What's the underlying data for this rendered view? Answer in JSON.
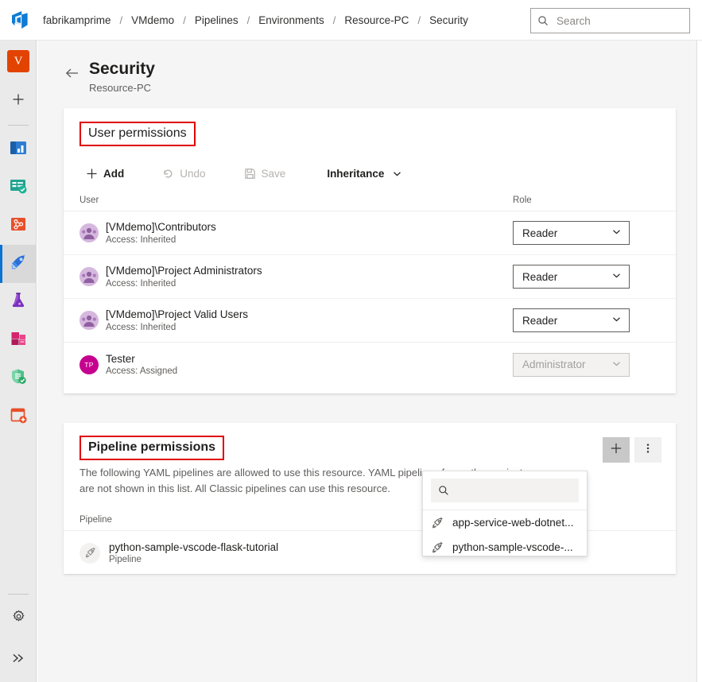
{
  "header": {
    "logo_icon": "azure-devops-logo",
    "breadcrumbs": [
      {
        "label": "fabrikamprime"
      },
      {
        "label": "VMdemo"
      },
      {
        "label": "Pipelines"
      },
      {
        "label": "Environments"
      },
      {
        "label": "Resource-PC"
      },
      {
        "label": "Security"
      }
    ],
    "separator": "/",
    "search": {
      "placeholder": "Search",
      "value": "",
      "icon": "search-icon"
    }
  },
  "sidebar": {
    "org_initial": "V",
    "items": [
      {
        "name": "new-item",
        "icon": "plus-icon",
        "active": false
      },
      {
        "name": "overview",
        "icon": "overview-icon",
        "active": false
      },
      {
        "name": "boards",
        "icon": "boards-icon",
        "active": false
      },
      {
        "name": "repos",
        "icon": "repos-icon",
        "active": false
      },
      {
        "name": "pipelines",
        "icon": "rocket-icon",
        "active": true
      },
      {
        "name": "test-plans",
        "icon": "flask-icon",
        "active": false
      },
      {
        "name": "artifacts",
        "icon": "artifacts-icon",
        "active": false
      },
      {
        "name": "advanced-security",
        "icon": "shield-check-icon",
        "active": false
      },
      {
        "name": "add-extension",
        "icon": "add-card-icon",
        "active": false
      }
    ],
    "bottom": [
      {
        "name": "project-settings",
        "icon": "gear-icon"
      },
      {
        "name": "expand-sidebar",
        "icon": "double-chevron-right-icon"
      }
    ]
  },
  "page": {
    "back_icon": "back-arrow-icon",
    "title": "Security",
    "subtitle": "Resource-PC"
  },
  "user_permissions": {
    "title": "User permissions",
    "toolbar": {
      "add": {
        "label": "Add",
        "icon": "plus-icon",
        "disabled": false
      },
      "undo": {
        "label": "Undo",
        "icon": "undo-icon",
        "disabled": true
      },
      "save": {
        "label": "Save",
        "icon": "save-icon",
        "disabled": true
      },
      "inheritance": {
        "label": "Inheritance",
        "icon": "chevron-down-icon",
        "disabled": false
      }
    },
    "columns": {
      "user": "User",
      "role": "Role"
    },
    "rows": [
      {
        "name": "[VMdemo]\\Contributors",
        "access": "Access: Inherited",
        "avatar_type": "group",
        "avatar_text": "",
        "role": "Reader",
        "role_disabled": false
      },
      {
        "name": "[VMdemo]\\Project Administrators",
        "access": "Access: Inherited",
        "avatar_type": "group",
        "avatar_text": "",
        "role": "Reader",
        "role_disabled": false
      },
      {
        "name": "[VMdemo]\\Project Valid Users",
        "access": "Access: Inherited",
        "avatar_type": "group",
        "avatar_text": "",
        "role": "Reader",
        "role_disabled": false
      },
      {
        "name": "Tester",
        "access": "Access: Assigned",
        "avatar_type": "initials",
        "avatar_text": "TP",
        "role": "Administrator",
        "role_disabled": true
      }
    ]
  },
  "pipeline_permissions": {
    "title": "Pipeline permissions",
    "description_line1": "The following YAML pipelines are allowed to use this resource. YAML pipelines from other projects",
    "description_line2": "are not shown in this list. All Classic pipelines can use this resource.",
    "add_button": {
      "icon": "plus-icon",
      "pressed": true
    },
    "more_button": {
      "icon": "more-vertical-icon",
      "pressed": false
    },
    "column": "Pipeline",
    "rows": [
      {
        "name": "python-sample-vscode-flask-tutorial",
        "type": "Pipeline",
        "icon": "rocket-icon"
      }
    ]
  },
  "pipeline_flyout": {
    "search": {
      "placeholder": "",
      "value": "",
      "icon": "search-icon"
    },
    "items": [
      {
        "label": "app-service-web-dotnet...",
        "icon": "rocket-icon"
      },
      {
        "label": "python-sample-vscode-...",
        "icon": "rocket-icon"
      }
    ]
  },
  "annotations": {
    "highlight_color": "#e00000"
  }
}
